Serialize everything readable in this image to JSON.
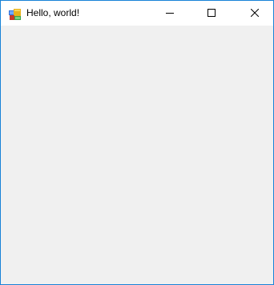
{
  "window": {
    "title": "Hello, world!",
    "icon": "winforms-app-icon",
    "border_color": "#1883d7",
    "titlebar_color": "#ffffff",
    "client_color": "#f0f0f0"
  },
  "caption_buttons": {
    "minimize_icon": "minimize-icon",
    "maximize_icon": "maximize-icon",
    "close_icon": "close-icon"
  }
}
